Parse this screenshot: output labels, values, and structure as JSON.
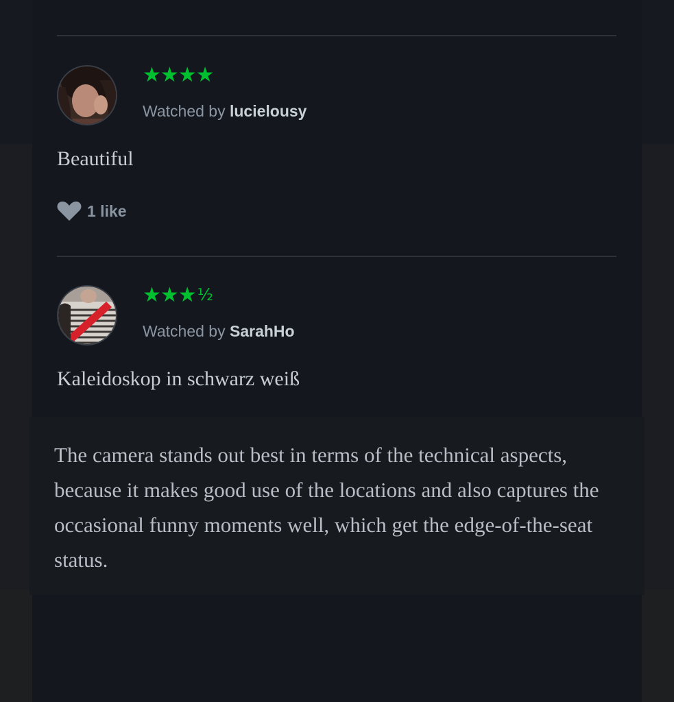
{
  "reviews": [
    {
      "rating_stars": "★★★★",
      "rating_half": "",
      "rating_value": 4,
      "watched_prefix": "Watched by ",
      "username": "lucielousy",
      "text": "Beautiful",
      "likes": "1 like",
      "avatar_icon": "user-photo-icon"
    },
    {
      "rating_stars": "★★★",
      "rating_half": "½",
      "rating_value": 3.5,
      "watched_prefix": "Watched by ",
      "username": "SarahHo",
      "text": "Kaleidoskop in schwarz weiß",
      "avatar_icon": "user-photo-icon"
    }
  ],
  "caption": "The camera stands out best in terms of the technical aspects, because it makes good use of the locations and also captures the occasional funny moments well, which get the edge-of-the-seat status.",
  "colors": {
    "star_green": "#00c030",
    "panel_bg": "#14181e",
    "muted_text": "#8b95a1"
  },
  "icons": {
    "like": "heart-icon"
  }
}
